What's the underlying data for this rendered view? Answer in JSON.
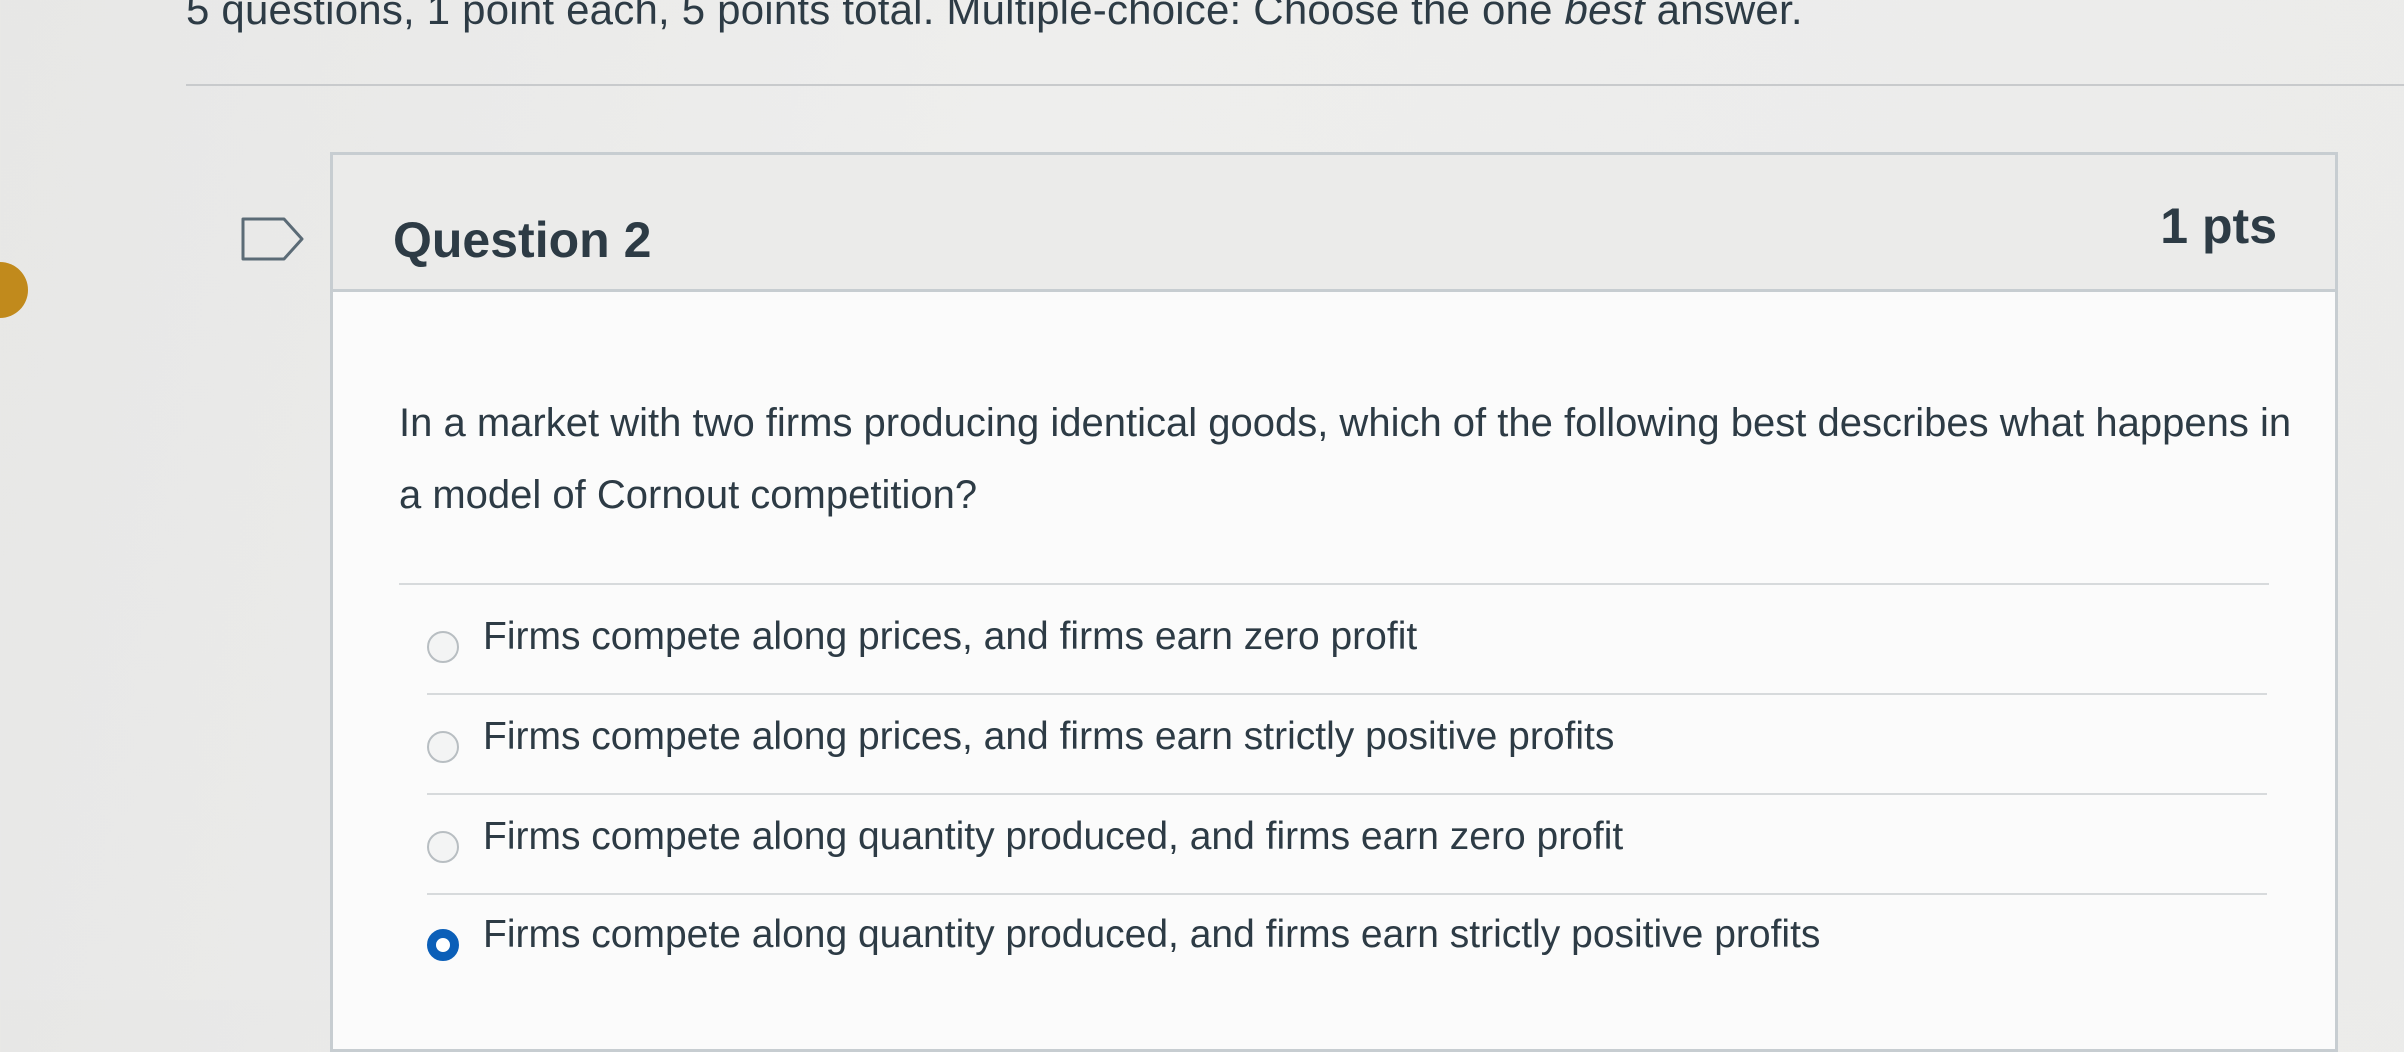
{
  "instructions": {
    "text_before": "5 questions, 1 point each, 5 points total. Multiple-choice: Choose the one ",
    "emphasis": "best",
    "text_after": " answer."
  },
  "question": {
    "title": "Question 2",
    "points": "1 pts",
    "text": "In a market with two firms producing identical goods, which of the following best describes what happens in a model of Cornout competition?",
    "answers": [
      {
        "label": "Firms compete along prices, and firms earn zero profit",
        "selected": false
      },
      {
        "label": "Firms compete along prices, and firms earn strictly positive profits",
        "selected": false
      },
      {
        "label": "Firms compete along quantity produced, and firms earn zero profit",
        "selected": false
      },
      {
        "label": "Firms compete along quantity produced, and firms earn strictly positive profits",
        "selected": true
      }
    ]
  },
  "icons": {
    "flag": "flag-question-icon"
  },
  "colors": {
    "accent": "#0b5fb8",
    "badge": "#c18a1c",
    "text": "#2d3b45"
  }
}
